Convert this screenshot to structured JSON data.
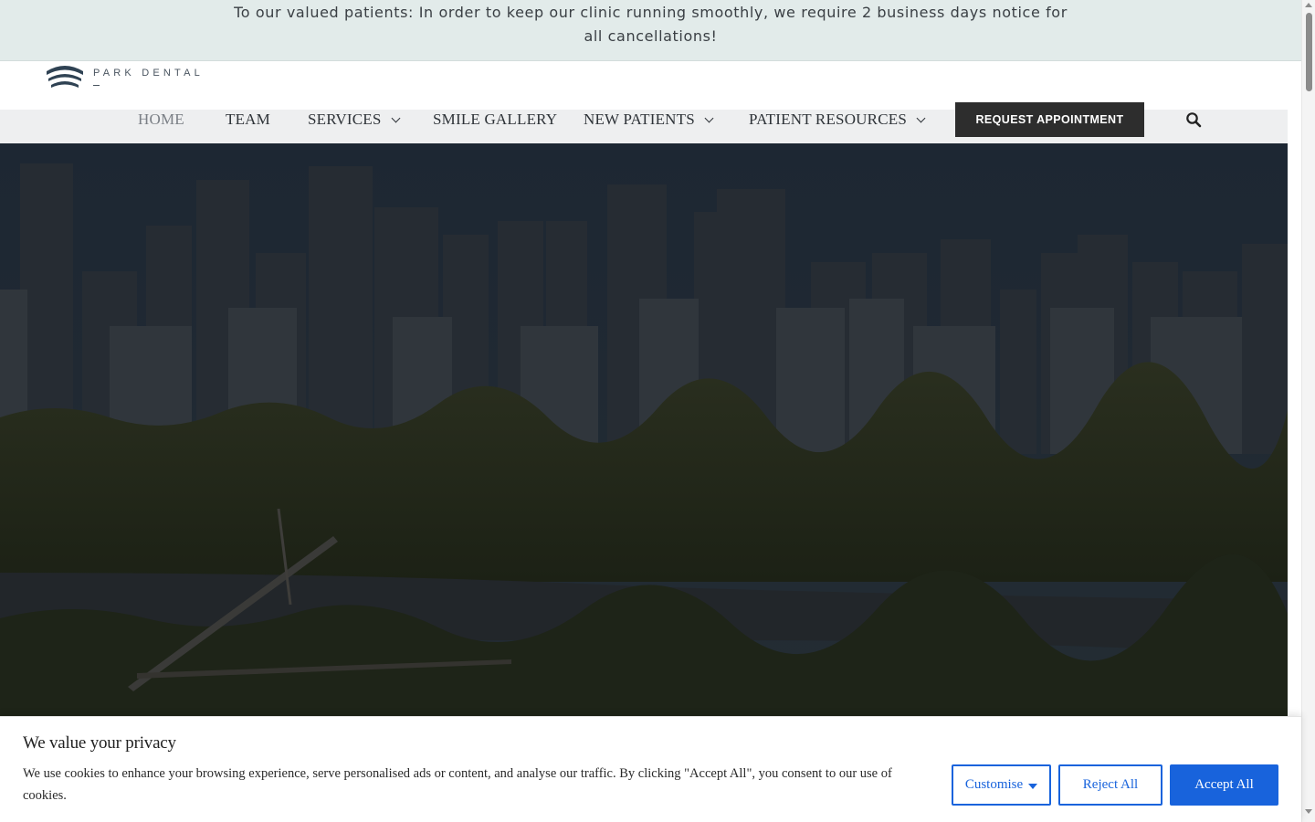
{
  "notice": {
    "text": "To our valued patients: In order to keep our clinic running smoothly, we require 2 business days notice for all cancellations!"
  },
  "brand": {
    "name": "PARK DENTAL"
  },
  "nav": {
    "items": [
      {
        "label": "HOME",
        "active": true,
        "dropdown": false
      },
      {
        "label": "TEAM",
        "active": false,
        "dropdown": false
      },
      {
        "label": "SERVICES",
        "active": false,
        "dropdown": true
      },
      {
        "label": "SMILE GALLERY",
        "active": false,
        "dropdown": false
      },
      {
        "label": "NEW PATIENTS",
        "active": false,
        "dropdown": true
      },
      {
        "label": "PATIENT RESOURCES",
        "active": false,
        "dropdown": true
      }
    ],
    "cta_label": "REQUEST APPOINTMENT",
    "search_icon": "search-icon"
  },
  "cookie": {
    "title": "We value your privacy",
    "text": "We use cookies to enhance your browsing experience, serve personalised ads or content, and analyse our traffic. By clicking \"Accept All\", you consent to our use of cookies.",
    "customise_label": "Customise",
    "reject_label": "Reject All",
    "accept_label": "Accept All"
  },
  "colors": {
    "notice_bg": "#e2ebea",
    "nav_bg": "#eeeff0",
    "cta_bg": "#2d2d2d",
    "cookie_accent": "#1863dc"
  }
}
